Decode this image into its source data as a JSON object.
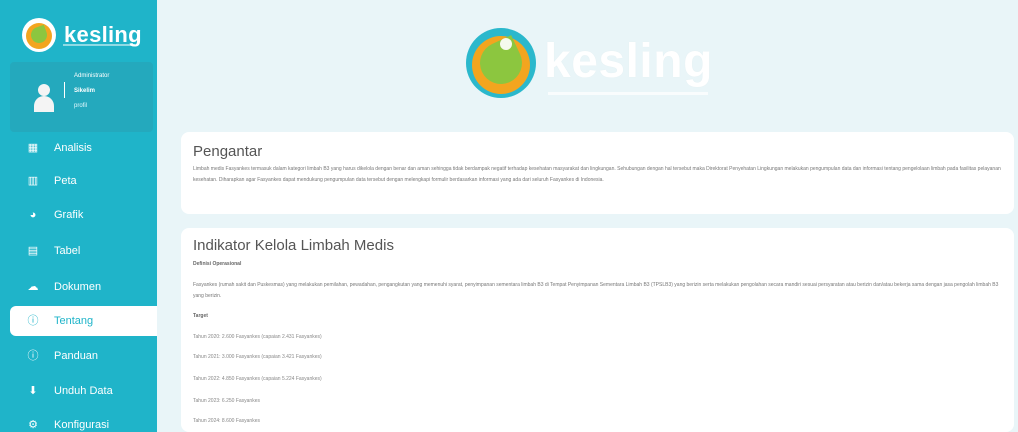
{
  "sidebar": {
    "brand": "kesling",
    "user": {
      "name": "Administrator",
      "role": "Sikelim",
      "link": "profil"
    },
    "items": [
      {
        "label": "Analisis",
        "icon": "chart-icon",
        "glyph": "▦"
      },
      {
        "label": "Peta",
        "icon": "map-icon",
        "glyph": "▥"
      },
      {
        "label": "Grafik",
        "icon": "pie-chart-icon",
        "glyph": "◕"
      },
      {
        "label": "Tabel",
        "icon": "table-icon",
        "glyph": "▤"
      },
      {
        "label": "Dokumen",
        "icon": "cloud-icon",
        "glyph": "☁"
      },
      {
        "label": "Tentang",
        "icon": "info-icon",
        "glyph": "ⓘ"
      },
      {
        "label": "Panduan",
        "icon": "info-icon",
        "glyph": "ⓘ"
      },
      {
        "label": "Unduh Data",
        "icon": "download-icon",
        "glyph": "⬇"
      },
      {
        "label": "Konfigurasi",
        "icon": "sliders-icon",
        "glyph": "⚙"
      }
    ],
    "active": "Tentang"
  },
  "header": {
    "brand": "kesling"
  },
  "intro": {
    "title": "Pengantar",
    "text": "Limbah medis Fasyankes termasuk dalam kategori limbah B3 yang harus dikelola dengan benar dan aman sehingga tidak berdampak negatif terhadap kesehatan masyarakat dan lingkungan. Sehubungan dengan hal tersebut maka Direktorat Penyehatan Lingkungan melakukan pengumpulan data dan informasi tentang pengelolaan limbah pada fasilitas pelayanan kesehatan. Diharapkan agar Fasyankes dapat mendukung pengumpulan data tersebut dengan melengkapi formulir berdasarkan informasi yang ada dari seluruh Fasyankes di Indonesia."
  },
  "indicator": {
    "title": "Indikator Kelola Limbah Medis",
    "def_label": "Definisi Operasional",
    "def_text": "Fasyankes (rumah sakit dan Puskesmas) yang melakukan pemilahan, pewadahan, pengangkutan yang memenuhi syarat, penyimpanan sementara limbah B3 di Tempat Penyimpanan Sementara Limbah B3 (TPSLB3) yang berizin serta melakukan pengolahan secara mandiri sesuai persyaratan atau berizin dan/atau bekerja sama dengan jasa pengolah limbah B3 yang berizin.",
    "target_label": "Target",
    "targets": [
      "Tahun 2020: 2.600 Fasyankes (capaian 2.431 Fasyankes)",
      "Tahun 2021: 3.000 Fasyankes (capaian 3.421 Fasyankes)",
      "Tahun 2022: 4.850 Fasyankes (capaian 5.224 Fasyankes)",
      "Tahun 2023: 6.250 Fasyankes",
      "Tahun 2024: 8.600 Fasyankes"
    ]
  }
}
